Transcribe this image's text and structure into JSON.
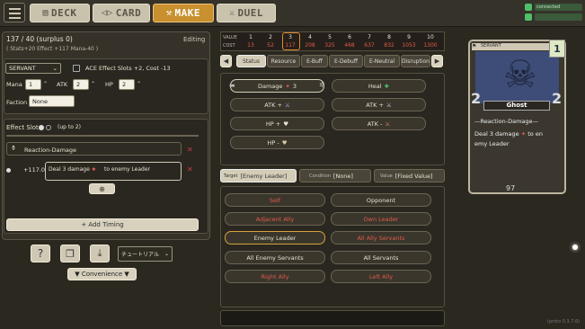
{
  "nav": {
    "tabs": [
      {
        "label": "DECK",
        "icon": "deck-icon"
      },
      {
        "label": "CARD",
        "icon": "card-icon"
      },
      {
        "label": "MAKE",
        "icon": "hammer-icon"
      },
      {
        "label": "DUEL",
        "icon": "swords-icon"
      }
    ],
    "active": "MAKE"
  },
  "connection": {
    "status": "connected"
  },
  "left": {
    "cost_line": "137 / 40  (surplus 0)",
    "editing": "Editing",
    "stats_line": "( Stats+20  Effect +117  Mana-40 )",
    "type_select": "SERVANT",
    "ace_label": "ACE Effect Slots +2, Cost -13",
    "mana_label": "Mana",
    "mana_value": "1",
    "atk_label": "ATK",
    "atk_value": "2",
    "hp_label": "HP",
    "hp_value": "2",
    "faction_label": "Faction",
    "faction_value": "None",
    "effect_slot_label": "Effect Slot",
    "effect_slot_hint": "(up to 2)",
    "timing": "Reaction-Damage",
    "effect_cost": "+117.0",
    "effect_text_a": "Deal 3 damage",
    "effect_text_b": "to enemy Leader",
    "add_timing": "+ Add Timing",
    "lang_select": "チュートリアル",
    "convenience": "▼ Convenience ▼"
  },
  "values": {
    "value_label": "VALUE",
    "cost_label": "COST",
    "value_row": [
      "1",
      "2",
      "3",
      "4",
      "5",
      "6",
      "7",
      "8",
      "9",
      "10"
    ],
    "cost_row": [
      "13",
      "52",
      "117",
      "208",
      "325",
      "468",
      "637",
      "832",
      "1053",
      "1300"
    ],
    "selected_index": 2
  },
  "effect_tabs": [
    "Status",
    "Resource",
    "E-Buff",
    "E-Debuff",
    "E-Neutral",
    "Disruption"
  ],
  "effects": {
    "damage": "Damage",
    "damage_value": "3",
    "heal": "Heal",
    "atk_plus": "ATK +",
    "atk_plus2": "ATK +",
    "atk_minus": "ATK -",
    "hp_plus": "HP +",
    "hp_minus": "HP -"
  },
  "target_tabs": {
    "target_label": "Target",
    "target_value": "[Enemy Leader]",
    "condition_label": "Condition",
    "condition_value": "[None]",
    "value_label": "Value",
    "value_value": "[Fixed Value]"
  },
  "targets": [
    "Self",
    "Opponent",
    "Adjacent Ally",
    "Own Leader",
    "Enemy Leader",
    "All Ally Servants",
    "All Enemy Servants",
    "All Servants",
    "Right Ally",
    "Left Ally"
  ],
  "card": {
    "type": "SERVANT",
    "mana": "1",
    "atk": "2",
    "hp": "2",
    "name": "Ghost",
    "ability_title": "—Reaction-Damage—",
    "ability_text_a": "Deal 3 damage",
    "ability_text_b": "to en",
    "ability_text_c": "emy Leader",
    "power": "97"
  },
  "version": "(proto 0.3.7.6)"
}
